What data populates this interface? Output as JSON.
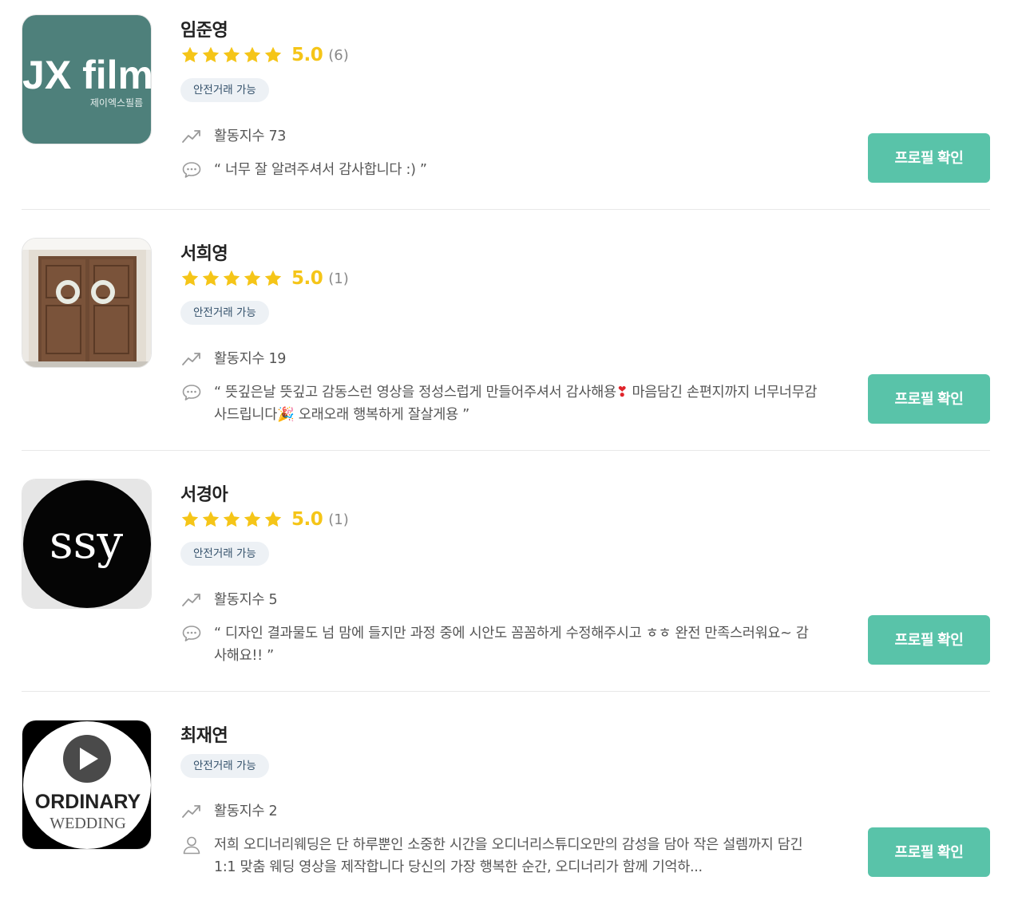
{
  "accent_color": "#59c3a9",
  "star_color": "#f5c518",
  "icons": {
    "activity": "trending-up-icon",
    "review": "speech-bubble-icon",
    "intro": "person-icon",
    "star": "star-icon"
  },
  "cards": [
    {
      "name": "임준영",
      "score": "5.0",
      "count": "(6)",
      "stars": 5,
      "badge": "안전거래 가능",
      "activity": "활동지수 73",
      "review": "“ 너무 잘 알려주셔서 감사합니다 :) ”",
      "button": "프로필 확인",
      "avatar": {
        "title": "JX film",
        "subtitle": "제이엑스필름",
        "bg": "#4e807b"
      }
    },
    {
      "name": "서희영",
      "score": "5.0",
      "count": "(1)",
      "stars": 5,
      "badge": "안전거래 가능",
      "activity": "활동지수 19",
      "review_parts": [
        "“ 뜻깊은날 뜻깊고 감동스런 영상을 정성스럽게 만들어주셔서 감사해용",
        "❣",
        " 마음담긴 손편지까지 너무너무감사드립니다",
        "🎉",
        " 오래오래 행복하게 잘살게용 ”"
      ],
      "button": "프로필 확인"
    },
    {
      "name": "서경아",
      "score": "5.0",
      "count": "(1)",
      "stars": 5,
      "badge": "안전거래 가능",
      "activity": "활동지수 5",
      "review": "“ 디자인 결과물도 넘 맘에 들지만 과정 중에 시안도 꼼꼼하게 수정해주시고 ㅎㅎ 완전 만족스러워요~ 감사해요!! ”",
      "button": "프로필 확인",
      "avatar": {
        "title": "ssy"
      }
    },
    {
      "name": "최재연",
      "badge": "안전거래 가능",
      "activity": "활동지수 2",
      "intro": "저희 오디너리웨딩은 단 하루뿐인 소중한 시간을 오디너리스튜디오만의 감성을 담아 작은 설렘까지 담긴 1:1 맞춤 웨딩 영상을 제작합니다 당신의 가장 행복한 순간, 오디너리가 함께 기억하...",
      "button": "프로필 확인",
      "avatar": {
        "title": "ORDINARY",
        "subtitle": "WEDDING"
      }
    }
  ]
}
